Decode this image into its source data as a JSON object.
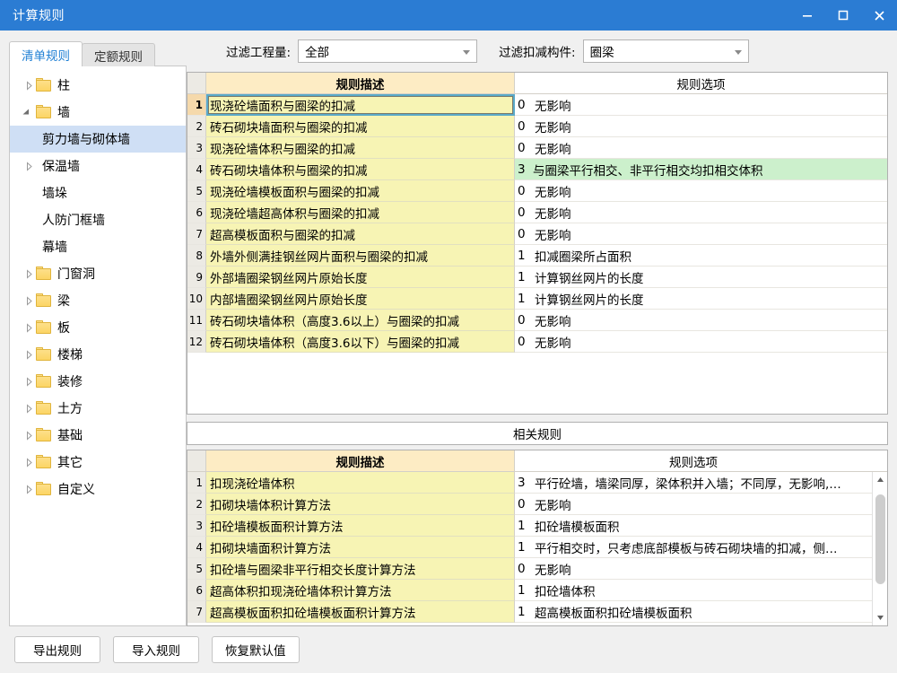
{
  "window": {
    "title": "计算规则",
    "controls": {
      "minimize": "–",
      "maximize": "□",
      "close": "✕"
    },
    "accent_color": "#2b7cd3"
  },
  "filters": {
    "quantity": {
      "label": "过滤工程量:",
      "value": "全部"
    },
    "component": {
      "label": "过滤扣减构件:",
      "value": "圈梁"
    }
  },
  "tabs": [
    {
      "label": "清单规则",
      "active": true
    },
    {
      "label": "定额规则",
      "active": false
    }
  ],
  "tree": [
    {
      "label": "柱",
      "state": "collapsed",
      "folder": true,
      "depth": 0,
      "selected": false
    },
    {
      "label": "墙",
      "state": "expanded",
      "folder": true,
      "depth": 0,
      "selected": false
    },
    {
      "label": "剪力墙与砌体墙",
      "state": "none",
      "folder": false,
      "depth": 1,
      "selected": true
    },
    {
      "label": "保温墙",
      "state": "collapsed",
      "folder": false,
      "depth": 1,
      "selected": false
    },
    {
      "label": "墙垛",
      "state": "none",
      "folder": false,
      "depth": 1,
      "selected": false
    },
    {
      "label": "人防门框墙",
      "state": "none",
      "folder": false,
      "depth": 1,
      "selected": false
    },
    {
      "label": "幕墙",
      "state": "none",
      "folder": false,
      "depth": 1,
      "selected": false
    },
    {
      "label": "门窗洞",
      "state": "collapsed",
      "folder": true,
      "depth": 0,
      "selected": false
    },
    {
      "label": "梁",
      "state": "collapsed",
      "folder": true,
      "depth": 0,
      "selected": false
    },
    {
      "label": "板",
      "state": "collapsed",
      "folder": true,
      "depth": 0,
      "selected": false
    },
    {
      "label": "楼梯",
      "state": "collapsed",
      "folder": true,
      "depth": 0,
      "selected": false
    },
    {
      "label": "装修",
      "state": "collapsed",
      "folder": true,
      "depth": 0,
      "selected": false
    },
    {
      "label": "土方",
      "state": "collapsed",
      "folder": true,
      "depth": 0,
      "selected": false
    },
    {
      "label": "基础",
      "state": "collapsed",
      "folder": true,
      "depth": 0,
      "selected": false
    },
    {
      "label": "其它",
      "state": "collapsed",
      "folder": true,
      "depth": 0,
      "selected": false
    },
    {
      "label": "自定义",
      "state": "collapsed",
      "folder": true,
      "depth": 0,
      "selected": false
    }
  ],
  "main_grid": {
    "columns": {
      "description": "规则描述",
      "option": "规则选项"
    },
    "rows": [
      {
        "n": "1",
        "desc": "现浇砼墙面积与圈梁的扣减",
        "code": "0",
        "opt": "无影响",
        "selected": true,
        "highlight": false
      },
      {
        "n": "2",
        "desc": "砖石砌块墙面积与圈梁的扣减",
        "code": "0",
        "opt": "无影响",
        "selected": false,
        "highlight": false
      },
      {
        "n": "3",
        "desc": "现浇砼墙体积与圈梁的扣减",
        "code": "0",
        "opt": "无影响",
        "selected": false,
        "highlight": false
      },
      {
        "n": "4",
        "desc": "砖石砌块墙体积与圈梁的扣减",
        "code": "3",
        "opt": "与圈梁平行相交、非平行相交均扣相交体积",
        "selected": false,
        "highlight": true
      },
      {
        "n": "5",
        "desc": "现浇砼墙模板面积与圈梁的扣减",
        "code": "0",
        "opt": "无影响",
        "selected": false,
        "highlight": false
      },
      {
        "n": "6",
        "desc": "现浇砼墙超高体积与圈梁的扣减",
        "code": "0",
        "opt": "无影响",
        "selected": false,
        "highlight": false
      },
      {
        "n": "7",
        "desc": "超高模板面积与圈梁的扣减",
        "code": "0",
        "opt": "无影响",
        "selected": false,
        "highlight": false
      },
      {
        "n": "8",
        "desc": "外墙外侧满挂钢丝网片面积与圈梁的扣减",
        "code": "1",
        "opt": "扣减圈梁所占面积",
        "selected": false,
        "highlight": false
      },
      {
        "n": "9",
        "desc": "外部墙圈梁钢丝网片原始长度",
        "code": "1",
        "opt": "计算钢丝网片的长度",
        "selected": false,
        "highlight": false
      },
      {
        "n": "10",
        "desc": "内部墙圈梁钢丝网片原始长度",
        "code": "1",
        "opt": "计算钢丝网片的长度",
        "selected": false,
        "highlight": false
      },
      {
        "n": "11",
        "desc": "砖石砌块墙体积（高度3.6以上）与圈梁的扣减",
        "code": "0",
        "opt": "无影响",
        "selected": false,
        "highlight": false
      },
      {
        "n": "12",
        "desc": "砖石砌块墙体积（高度3.6以下）与圈梁的扣减",
        "code": "0",
        "opt": "无影响",
        "selected": false,
        "highlight": false
      }
    ]
  },
  "related_section": {
    "title": "相关规则",
    "columns": {
      "description": "规则描述",
      "option": "规则选项"
    },
    "rows": [
      {
        "n": "1",
        "desc": "扣现浇砼墙体积",
        "code": "3",
        "opt": "平行砼墙，墙梁同厚，梁体积并入墙；不同厚，无影响,…"
      },
      {
        "n": "2",
        "desc": "扣砌块墙体积计算方法",
        "code": "0",
        "opt": "无影响"
      },
      {
        "n": "3",
        "desc": "扣砼墙模板面积计算方法",
        "code": "1",
        "opt": "扣砼墙模板面积"
      },
      {
        "n": "4",
        "desc": "扣砌块墙面积计算方法",
        "code": "1",
        "opt": "平行相交时，只考虑底部模板与砖石砌块墙的扣减，侧…"
      },
      {
        "n": "5",
        "desc": "扣砼墙与圈梁非平行相交长度计算方法",
        "code": "0",
        "opt": "无影响"
      },
      {
        "n": "6",
        "desc": "超高体积扣现浇砼墙体积计算方法",
        "code": "1",
        "opt": "扣砼墙体积"
      },
      {
        "n": "7",
        "desc": "超高模板面积扣砼墙模板面积计算方法",
        "code": "1",
        "opt": "超高模板面积扣砼墙模板面积"
      }
    ]
  },
  "footer": {
    "export_label": "导出规则",
    "import_label": "导入规则",
    "reset_label": "恢复默认值"
  }
}
